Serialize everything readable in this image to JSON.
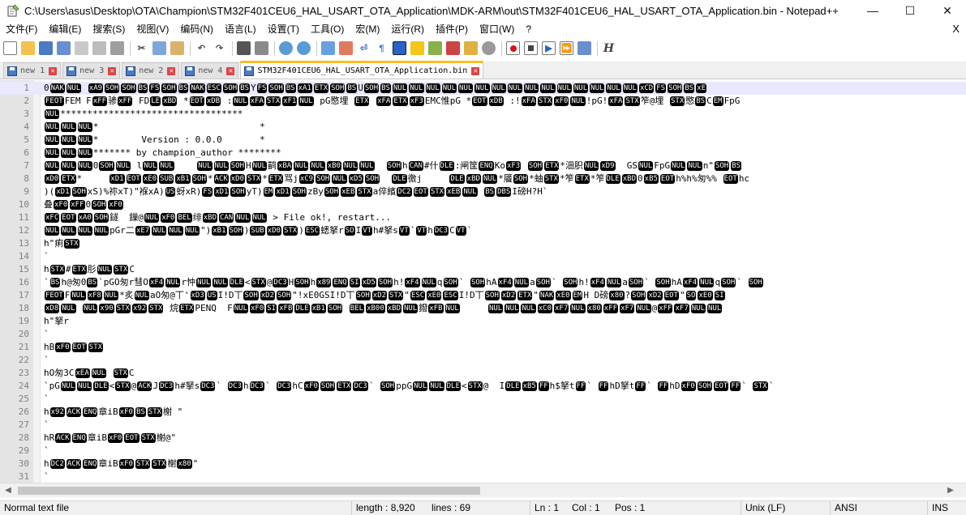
{
  "window": {
    "title": "C:\\Users\\asus\\Desktop\\OTA\\Champion\\STM32F401CEU6_HAL_USART_OTA_Application\\MDK-ARM\\out\\STM32F401CEU6_HAL_USART_OTA_Application.bin - Notepad++",
    "minimize": "—",
    "maximize": "☐",
    "close": "✕"
  },
  "menu": {
    "items": [
      "文件(F)",
      "编辑(E)",
      "搜索(S)",
      "视图(V)",
      "编码(N)",
      "语言(L)",
      "设置(T)",
      "工具(O)",
      "宏(M)",
      "运行(R)",
      "插件(P)",
      "窗口(W)",
      "?"
    ],
    "close": "X"
  },
  "toolbar": {
    "buttons": [
      "new-file-icon",
      "open-file-icon",
      "save-icon",
      "save-all-icon",
      "close-icon",
      "close-all-icon",
      "print-icon",
      "cut-icon",
      "copy-icon",
      "paste-icon",
      "undo-icon",
      "redo-icon",
      "find-icon",
      "replace-icon",
      "zoom-in-icon",
      "zoom-out-icon",
      "sync-vertical-icon",
      "sync-horizontal-icon",
      "word-wrap-icon",
      "show-all-chars-icon",
      "indent-guide-icon",
      "udl-icon",
      "doc-map-icon",
      "function-list-icon",
      "folder-workspace-icon",
      "monitor-icon",
      "record-macro-icon",
      "stop-record-icon",
      "playback-icon",
      "run-multiple-icon",
      "save-macro-icon",
      "h-icon"
    ]
  },
  "tabs": [
    {
      "label": "new 1",
      "active": false
    },
    {
      "label": "new 3",
      "active": false
    },
    {
      "label": "new 2",
      "active": false
    },
    {
      "label": "new 4",
      "active": false
    },
    {
      "label": "STM32F401CEU6_HAL_USART_OTA_Application.bin",
      "active": true
    }
  ],
  "editor": {
    "lines": [
      {
        "n": "1",
        "t": "0[NAK][NUL] [xA9][SOH][SOH][BS][FS][SOH][BS][NAK][ESC][SOH][BS]Y[FS][SOH][BS][xA1][ETX][SOH][BS]U[SOH][BS][NUL][NUL][NUL][NUL][NUL][NUL][NUL][NUL][NUL][NUL][NUL][NUL][NUL][NUL][NUL][xCD][FS][SOH][BS][xE]"
      },
      {
        "n": "2",
        "t": "[FEOT]FEM F[xFF]骖[xFF] FD[LE][xBD] *[EOT][xDB] :[NUL][xFA][STX][xF1][NUL] pG愍埋 [ETX] [xFA][ETX][xF3]EMC惟pG *[EOT][xDB] :![xFA][STX][xF0][NUL]!pG![xFA][STX]笮@埋 [STX]愍[BS]C[EM]FpG"
      },
      {
        "n": "3",
        "t": "[NUL]**********************************"
      },
      {
        "n": "4",
        "t": "[NUL][NUL][NUL]*                              *"
      },
      {
        "n": "5",
        "t": "[NUL][NUL][NUL]*        Version : 0.0.0       *"
      },
      {
        "n": "6",
        "t": "[NUL][NUL][NUL]******* by champion_author ********"
      },
      {
        "n": "7",
        "t": "[NUL][NUL][NUL]0[SOH][NUL] l[NUL][NUL]    [NUL][NUL][SOH]H[NUL]鹋[xBA][NUL][NUL][xB0][NUL][NUL]  [SOH]h[CAN]#什[DLE]:闸筐[ENQ]Ko[xF3] [SOH][ETX]*沺胑[NUL][xD9]  GS[NUL]FpG[NUL][NUL]n\"[SOH][BS]"
      },
      {
        "n": "8",
        "t": "[xD0][ETX]*     [xD1][EOT][xE0][SUB][xB1][SOH]*[ACK][xD0][STX]*[ETX]骂j[xC9][SOH][NUL][xD5][SOH]  [DLE]徼j     [DLE][xBD][NUL]*餍[SOH]*蚰[STX]*笮[ETX]*笮[DLE][xBD]0[xB5][EOT]h%h%匆%% [EOT]hc"
      },
      {
        "n": "9",
        "t": ")([xD1][SOH]xS)%祢xT)\"褓xA)[US]蚜xR)[FS][xD1][SOH]yT)[EM][xD1][SOH]zBy[SOH][xEB][STX]a倅繽[DC2][EOT][STX][xEB][NUL] [BS][DBS]I磅H?H`"
      },
      {
        "n": "10",
        "t": "叠[xF0][xFF]0[SOH][xF0]"
      },
      {
        "n": "11",
        "t": "[xFC][EOT][xA0][SOH]鐩  鏁@[NUL][xF0][BEL]绯[xBD][CAN][NUL][NUL] > File ok!, restart..."
      },
      {
        "n": "12",
        "t": "[NUL][NUL][NUL][NUL]pGr二[xE7][NUL][NUL][NUL]\")[xB1][SOH])[SUB][xD0][STX])[ESC]蟋拏r[SO]I[VT]h#拏s[VT]`[VT]h[DC3]C[VT]`"
      },
      {
        "n": "13",
        "t": "h\"痢[STX]"
      },
      {
        "n": "14",
        "t": "`"
      },
      {
        "n": "15",
        "t": "h[STX]#[ETX]肜[NUL][STX]C"
      },
      {
        "n": "16",
        "t": "`[BS]h@匆0[BS]`pGO匆r彗O[xF4][NUL]r忡[NUL][NUL][DLE]<[STX]@[DC3]H[SOH]h[x89][ENQ][SI][xD5][SOH]h![xF4][NUL]q[SOH]` [SOH]hA[xF4][NUL]a[SOH]` [SOH]h![xF4][NUL]a[SOH]` [SOH]hA[xF4][NUL]q[SOH]` [SOH]"
      },
      {
        "n": "17",
        "t": "[FEOT]F[NUL][xF8][NUL]*炙[NUL]aO匆@丅'[xD3][US]I!D丅[SOH][xD2][SOH]\"!xE0GSI!D丅[SOH][xD2][STX]\"[ESC][xE0][ESC]I!D丅[SOH][xD2][ETX]\"[NAK][xE0][EM]H D磅[x80]?[SOH][xD2][EOT]\"[SO][xE0][SI]"
      },
      {
        "n": "18",
        "t": "[xD8][NUL] [NUL][x90][STX][x92][STX] 烷[ETX]PENQ  F[NUL][xF0][SI][xFB][DLE][xB1][SOH] [BEL][xB00][xBD][NUL]鏺[xFB][NUL]     [NUL][NUL][NUL][xC0][xF7][NUL][x80][xFF][xF7][NUL]@[xFF][xF7][NUL][NUL]"
      },
      {
        "n": "19",
        "t": "h\"拏r"
      },
      {
        "n": "20",
        "t": "`"
      },
      {
        "n": "21",
        "t": "hB[xF0][EOT][STX]"
      },
      {
        "n": "22",
        "t": "`"
      },
      {
        "n": "23",
        "t": "hO匆3C[xEA][NUL] [STX]C"
      },
      {
        "n": "24",
        "t": "`pG[NUL][NUL][DLE]<[STX]@[ACK]J[DC3]h#拏s[DC3]` [DC3]h[DC3]` [DC3]hC[xF0][SOH][ETX][DC3]` [SOH]ppG[NUL][NUL][DLE]<[STX]@  I[DLE][xB5][FF]h$拏t[FF]` [FF]hD拏t[FF]` [FF]hD[xF0][SOH][EOT][FF]` [STX]`"
      },
      {
        "n": "25",
        "t": "`"
      },
      {
        "n": "26",
        "t": "h[x92][ACK][ENQ]章iB[xF0][BS][STX]榭 \""
      },
      {
        "n": "27",
        "t": "`"
      },
      {
        "n": "28",
        "t": "hR[ACK][ENQ]章iB[xF0][EOT][STX]榭@\""
      },
      {
        "n": "29",
        "t": "`"
      },
      {
        "n": "30",
        "t": "h[DC2][ACK][ENQ]章iB[xF0][STX][STX]榭[x80]\""
      },
      {
        "n": "31",
        "t": "`"
      }
    ]
  },
  "status": {
    "file_type": "Normal text file",
    "length": "length : 8,920",
    "lines": "lines : 69",
    "ln": "Ln : 1",
    "col": "Col : 1",
    "pos": "Pos : 1",
    "eol": "Unix (LF)",
    "encoding": "ANSI",
    "mode": "INS"
  }
}
